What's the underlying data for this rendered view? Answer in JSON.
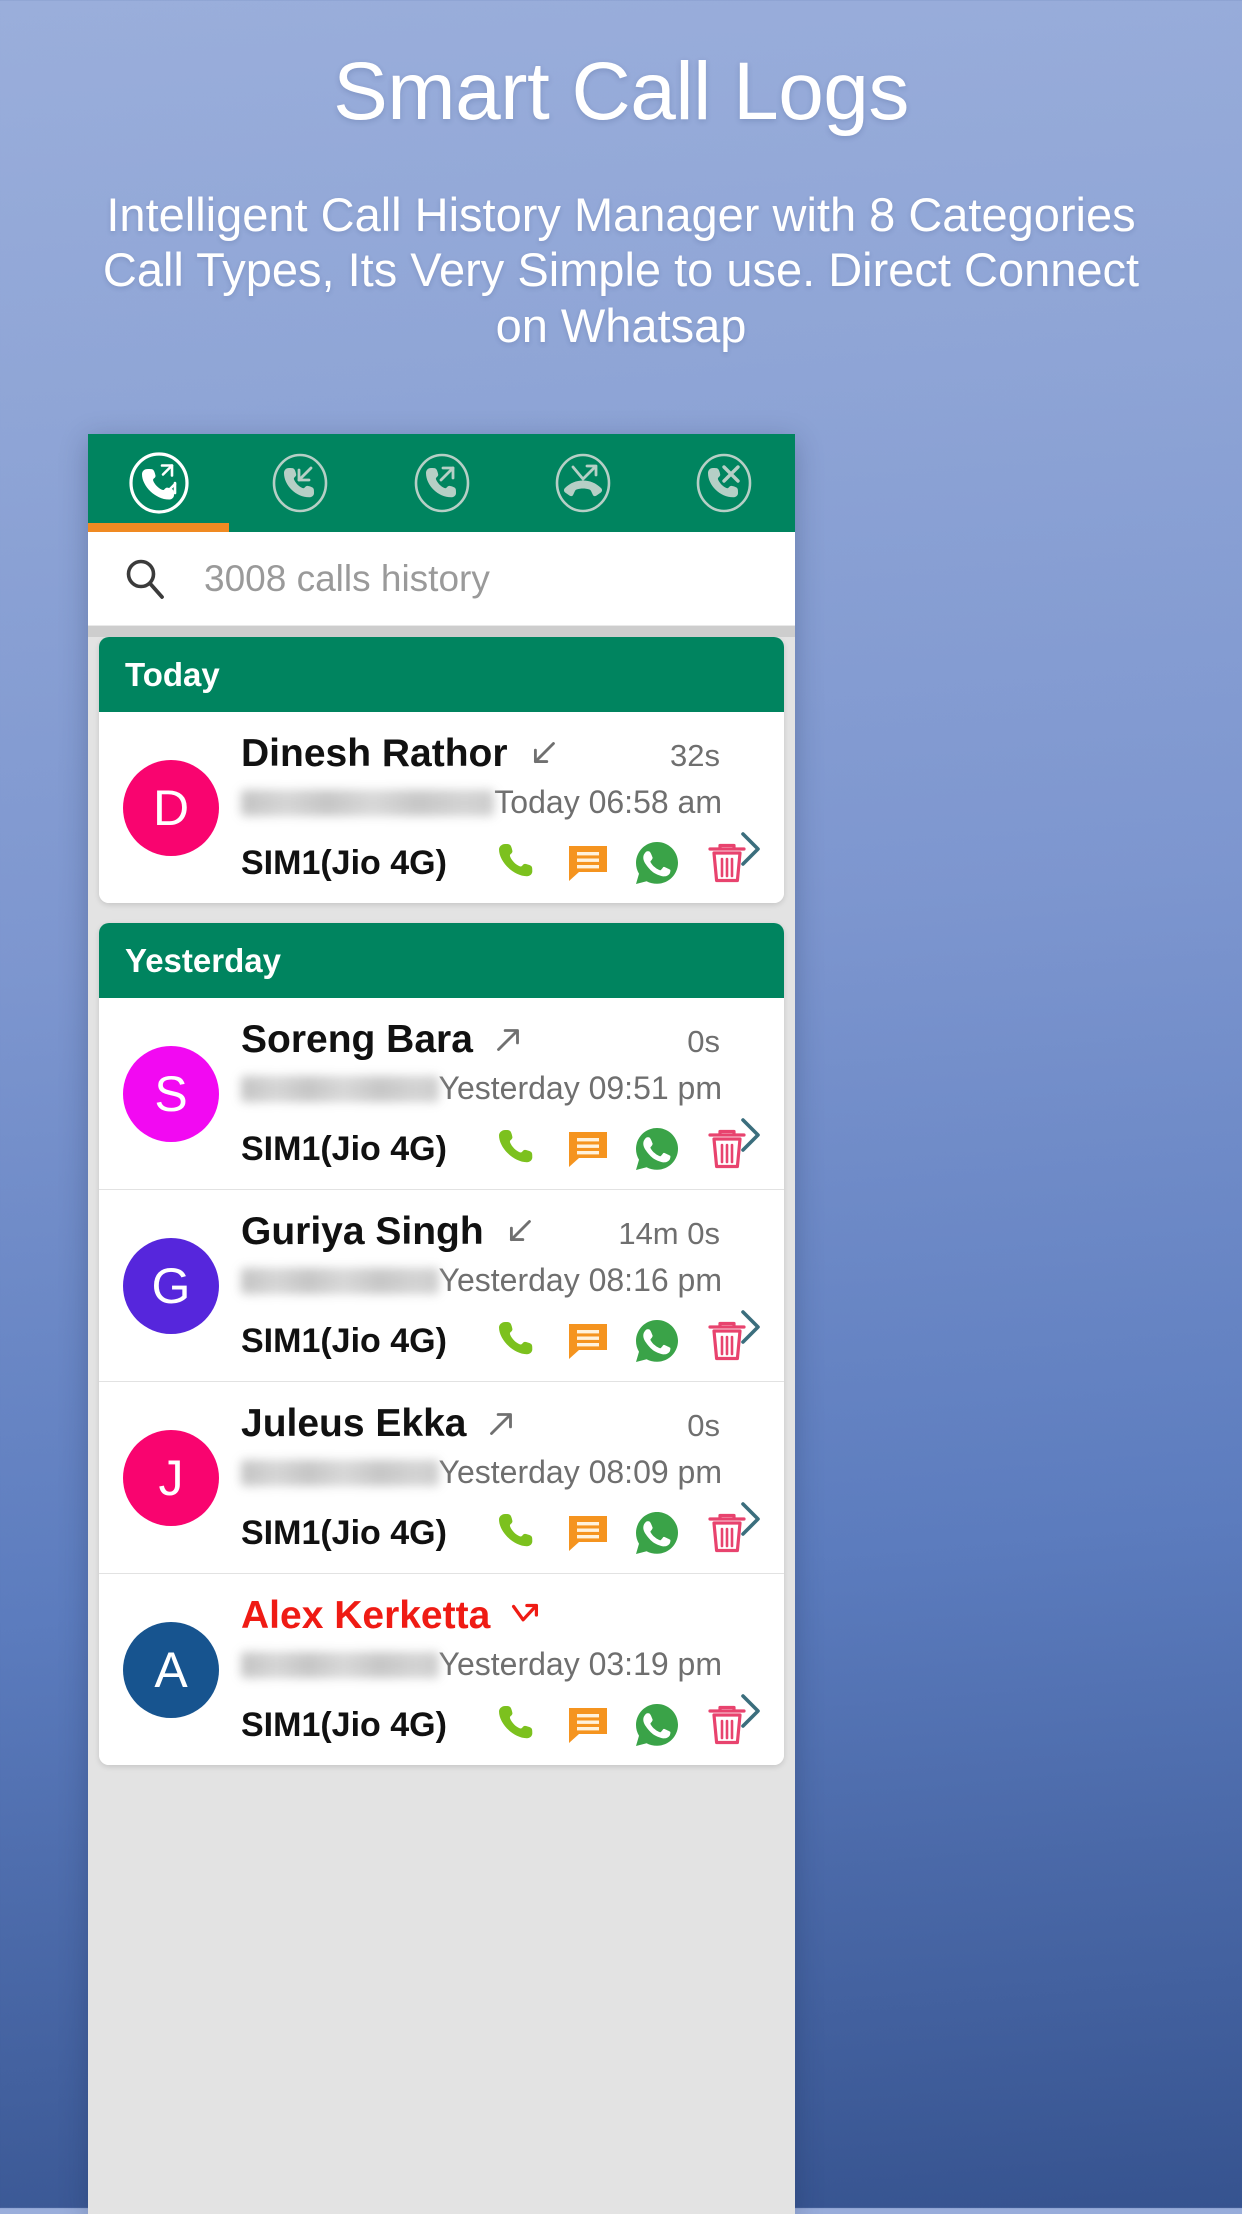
{
  "promo": {
    "title": "Smart Call Logs",
    "subtitle": "Intelligent Call History Manager with 8 Categories Call Types,  Its Very Simple to use. Direct Connect on Whatsap"
  },
  "theme": {
    "green": "#00845f",
    "orange_accent": "#f08a22",
    "missed_red": "#ef1b14",
    "sms_orange": "#f5941f",
    "call_green": "#7cc11e",
    "whatsapp_green": "#3aa348",
    "delete_pink": "#e8436e"
  },
  "tabs": [
    {
      "name": "all-calls",
      "icon": "phone-all-calls-icon",
      "active": true
    },
    {
      "name": "incoming-calls",
      "icon": "phone-incoming-icon",
      "active": false
    },
    {
      "name": "outgoing-calls",
      "icon": "phone-outgoing-icon",
      "active": false
    },
    {
      "name": "missed-calls",
      "icon": "phone-missed-icon",
      "active": false
    },
    {
      "name": "rejected-calls",
      "icon": "phone-rejected-icon",
      "active": false
    }
  ],
  "search": {
    "icon": "search-icon",
    "placeholder": "3008 calls history",
    "value": ""
  },
  "row_actions": [
    {
      "name": "call-action",
      "icon": "phone-handset-icon"
    },
    {
      "name": "sms-action",
      "icon": "message-bubble-icon"
    },
    {
      "name": "whatsapp-action",
      "icon": "whatsapp-icon"
    },
    {
      "name": "delete-action",
      "icon": "trash-icon"
    }
  ],
  "groups": [
    {
      "header": "Today",
      "rows": [
        {
          "initial": "D",
          "avatar_color": "#f9046f",
          "name": "Dinesh Rathor",
          "direction": "incoming",
          "missed": false,
          "duration": "32s",
          "when": "Today 06:58 am",
          "sim": "SIM1(Jio 4G)"
        }
      ]
    },
    {
      "header": "Yesterday",
      "rows": [
        {
          "initial": "S",
          "avatar_color": "#f209f2",
          "name": "Soreng Bara",
          "direction": "outgoing",
          "missed": false,
          "duration": "0s",
          "when": "Yesterday 09:51 pm",
          "sim": "SIM1(Jio 4G)"
        },
        {
          "initial": "G",
          "avatar_color": "#5626dc",
          "name": "Guriya Singh",
          "direction": "incoming",
          "missed": false,
          "duration": "14m 0s",
          "when": "Yesterday 08:16 pm",
          "sim": "SIM1(Jio 4G)"
        },
        {
          "initial": "J",
          "avatar_color": "#f9046f",
          "name": "Juleus Ekka",
          "direction": "outgoing",
          "missed": false,
          "duration": "0s",
          "when": "Yesterday 08:09 pm",
          "sim": "SIM1(Jio 4G)"
        },
        {
          "initial": "A",
          "avatar_color": "#17548f",
          "name": "Alex Kerketta",
          "direction": "rejected",
          "missed": true,
          "duration": "",
          "when": "Yesterday 03:19 pm",
          "sim": "SIM1(Jio 4G)"
        }
      ]
    }
  ]
}
